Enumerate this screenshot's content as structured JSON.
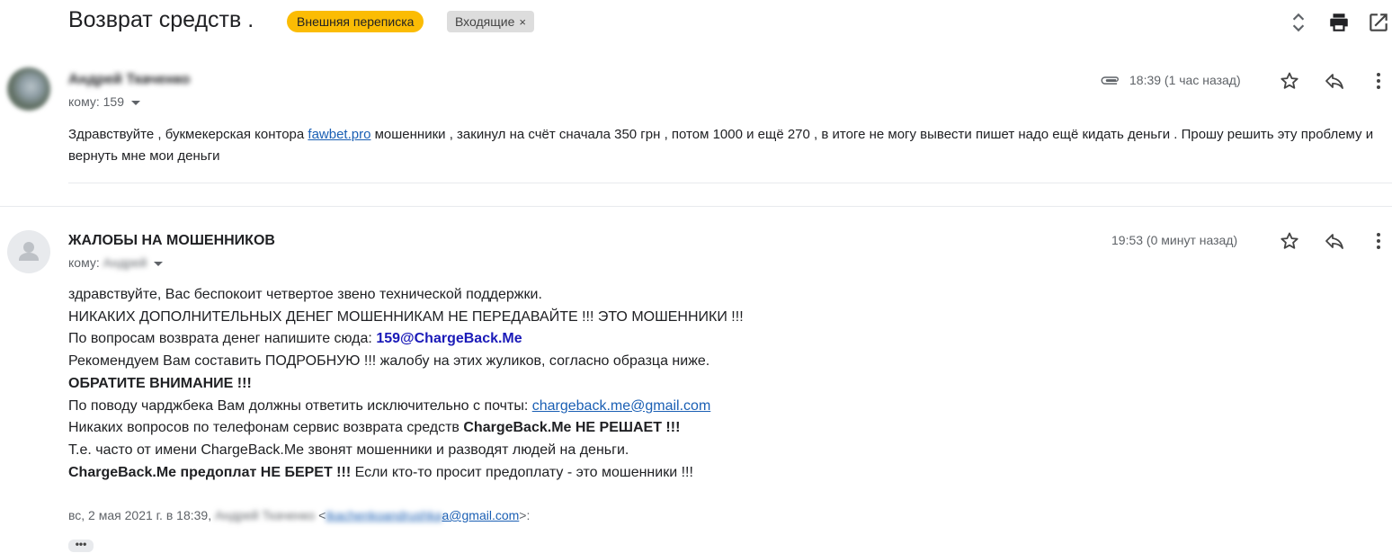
{
  "header": {
    "subject": "Возврат средств .",
    "labels": {
      "external": "Внешняя переписка",
      "inbox": "Входящие",
      "inbox_remove": "×"
    },
    "icons": [
      "expand-collapse-icon",
      "print-icon",
      "open-in-new-window-icon"
    ]
  },
  "message1": {
    "sender": "Андрей Ткаченко",
    "recipient_label": "кому:",
    "recipient": "159",
    "time": "18:39 (1 час назад)",
    "has_attachment": true,
    "body_parts": {
      "before_link": "Здравствуйте , букмекерская контора ",
      "link": "fawbet.pro",
      "after_link": " мошенники , закинул на счёт сначала 350 грн , потом 1000 и ещё 270 , в итоге не могу вывести пишет надо ещё кидать деньги . Прошу решить эту проблему и вернуть мне мои деньги"
    }
  },
  "message2": {
    "sender": "ЖАЛОБЫ НА МОШЕННИКОВ",
    "recipient_label": "кому:",
    "recipient": "Андрей",
    "time": "19:53 (0 минут назад)",
    "lines": {
      "l1": "здравствуйте, Вас беспокоит четвертое звено технической поддержки.",
      "l2": "НИКАКИХ ДОПОЛНИТЕЛЬНЫХ ДЕНЕГ МОШЕННИКАМ НЕ ПЕРЕДАВАЙТЕ !!! ЭТО МОШЕННИКИ !!!",
      "l3_text": "По вопросам возврата денег напишите сюда: ",
      "l3_email": "159@ChargeBack.Me",
      "l4": "Рекомендуем Вам составить ПОДРОБНУЮ !!! жалобу на этих жуликов, согласно образца ниже.",
      "l5": "ОБРАТИТЕ ВНИМАНИЕ !!!",
      "l6_text": "По поводу чарджбека Вам должны ответить исключительно с почты: ",
      "l6_email": "chargeback.me@gmail.com",
      "l7_text": "Никаких вопросов по телефонам сервис возврата средств ",
      "l7_bold": "ChargeBack.Me НЕ РЕШАЕТ !!!",
      "l8": "Т.е. часто от имени ChargeBack.Me звонят мошенники и разводят людей на деньги.",
      "l9_bold": "ChargeBack.Me предоплат НЕ БЕРЕТ !!!",
      "l9_text": " Если кто-то просит предоплату - это мошенники !!!"
    },
    "quote": {
      "prefix": "вс, 2 мая 2021 г. в 18:39, ",
      "name": "Андрей Ткаченко",
      "lt": " <",
      "email_hidden": "tkachenkoandrushka",
      "email_visible": "a@gmail.com",
      "suffix": ">:"
    },
    "show_trimmed": "•••"
  },
  "colors": {
    "label_external": "#fbbc04",
    "label_inbox": "#dddddd",
    "link": "#1a5fb4",
    "text": "#202124",
    "secondary": "#5f6368"
  }
}
